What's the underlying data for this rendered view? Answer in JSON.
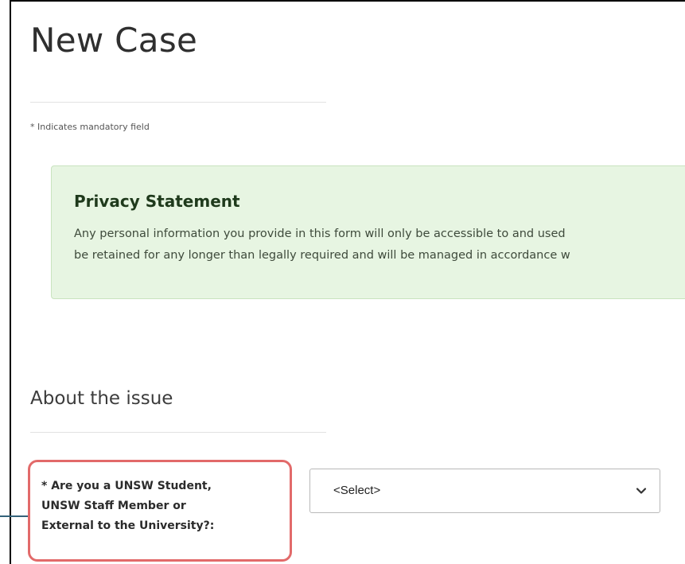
{
  "page": {
    "title": "New Case",
    "mandatory_note": "* Indicates mandatory field"
  },
  "privacy": {
    "title": "Privacy Statement",
    "line1": "Any personal information you provide in this form will only be accessible to and used",
    "line2": "be retained for any longer than legally required and will be managed in accordance w"
  },
  "section": {
    "heading": "About the issue"
  },
  "field": {
    "label": "* Are you a UNSW Student,\nUNSW Staff Member or\nExternal to the University?:",
    "select_value": "<Select>"
  },
  "colors": {
    "highlight": "#e26a6a",
    "privacy_bg": "#e7f5e2",
    "privacy_title": "#1f3a1c"
  },
  "icons": {
    "dropdown": "chevron-down-icon"
  }
}
